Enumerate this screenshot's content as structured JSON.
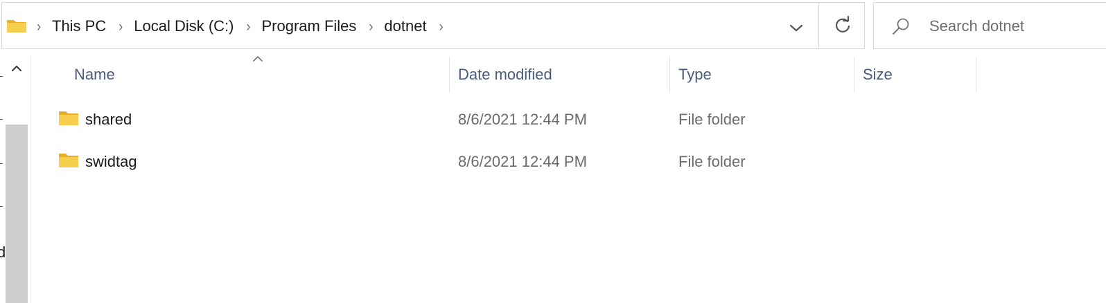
{
  "address_bar": {
    "breadcrumbs": [
      "This PC",
      "Local Disk (C:)",
      "Program Files",
      "dotnet"
    ],
    "dropdown_icon": "chevron-down-icon",
    "refresh_icon": "refresh-icon"
  },
  "search": {
    "placeholder": "Search dotnet",
    "icon": "search-icon"
  },
  "nav_pane": {
    "partial_text": "d"
  },
  "columns": {
    "name": "Name",
    "date_modified": "Date modified",
    "type": "Type",
    "size": "Size",
    "sort_indicator": "caret-up-icon"
  },
  "files": [
    {
      "name": "shared",
      "date_modified": "8/6/2021 12:44 PM",
      "type": "File folder",
      "size": ""
    },
    {
      "name": "swidtag",
      "date_modified": "8/6/2021 12:44 PM",
      "type": "File folder",
      "size": ""
    }
  ],
  "colors": {
    "folder": "#f4c430",
    "header_text": "#4a5a7a",
    "secondary_text": "#6b6b6b",
    "scrollbar": "#cdcdcd"
  }
}
